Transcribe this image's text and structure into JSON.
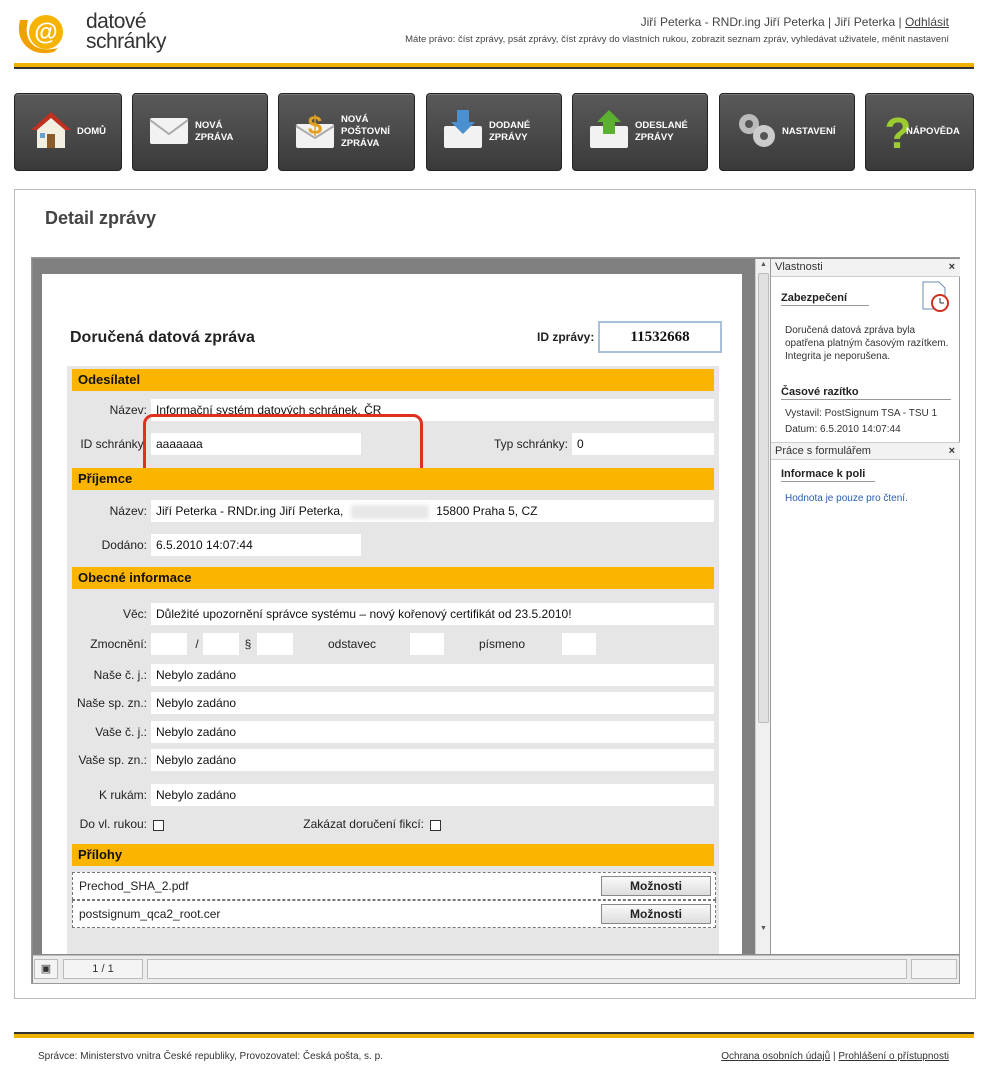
{
  "logo": {
    "line1": "datové",
    "line2": "schránky"
  },
  "header": {
    "user": "Jiří Peterka - RNDr.ing Jiří Peterka | Jiří Peterka |",
    "logout": "Odhlásit",
    "rights": "Máte právo: číst zprávy, psát zprávy, číst zprávy do vlastních rukou, zobrazit seznam zpráv, vyhledávat uživatele, měnit nastavení"
  },
  "nav": [
    {
      "label": "DOMŮ",
      "icon": "house-icon"
    },
    {
      "label": "NOVÁ\nZPRÁVA",
      "icon": "envelope-icon"
    },
    {
      "label": "NOVÁ\nPOŠTOVNÍ\nZPRÁVA",
      "icon": "dollar-envelope-icon"
    },
    {
      "label": "DODANÉ\nZPRÁVY",
      "icon": "inbox-icon"
    },
    {
      "label": "ODESLANÉ\nZPRÁVY",
      "icon": "outbox-icon"
    },
    {
      "label": "NASTAVENÍ",
      "icon": "gears-icon"
    },
    {
      "label": "NÁPOVĚDA",
      "icon": "question-icon"
    }
  ],
  "page_title": "Detail zprávy",
  "doc": {
    "title": "Doručená datová zpráva",
    "id_label": "ID zprávy:",
    "id_value": "11532668",
    "sender_section": "Odesílatel",
    "sender_name_label": "Název:",
    "sender_name": "Informační systém datových schránek, ČR",
    "sender_id_label": "ID schránky:",
    "sender_id": "aaaaaaa",
    "box_type_label": "Typ schránky:",
    "box_type": "0",
    "recipient_section": "Příjemce",
    "recipient_name_label": "Název:",
    "recipient_name": "Jiří Peterka - RNDr.ing Jiří Peterka,",
    "recipient_address": "15800 Praha 5, CZ",
    "delivered_label": "Dodáno:",
    "delivered": "6.5.2010 14:07:44",
    "general_section": "Obecné informace",
    "subject_label": "Věc:",
    "subject": "Důležité upozornění správce systému – nový kořenový certifikát od 23.5.2010!",
    "auth_label": "Zmocnění:",
    "auth_slash": "/",
    "auth_par": "§",
    "auth_odst": "odstavec",
    "auth_pism": "písmeno",
    "our_ref_label": "Naše č. j.:",
    "our_ref": "Nebylo zadáno",
    "our_file_label": "Naše sp. zn.:",
    "our_file": "Nebylo zadáno",
    "your_ref_label": "Vaše č. j.:",
    "your_ref": "Nebylo zadáno",
    "your_file_label": "Vaše sp. zn.:",
    "your_file": "Nebylo zadáno",
    "to_hands_label": "K rukám:",
    "to_hands": "Nebylo zadáno",
    "own_hands_label": "Do vl. rukou:",
    "no_fiction_label": "Zakázat doručení fikcí:",
    "attachments_section": "Přílohy",
    "attachments": [
      {
        "name": "Prechod_SHA_2.pdf",
        "button": "Možnosti"
      },
      {
        "name": "postsignum_qca2_root.cer",
        "button": "Možnosti"
      }
    ]
  },
  "side": {
    "props_head": "Vlastnosti",
    "security": "Zabezpečení",
    "security_text": "Doručená datová zpráva byla opatřena platným časovým razítkem. Integrita je neporušena.",
    "timestamp": "Časové razítko",
    "issuer": "Vystavil:  PostSignum TSA - TSU 1",
    "date": "Datum:   6.5.2010 14:07:44",
    "forms_head": "Práce s formulářem",
    "field_info": "Informace k poli",
    "field_info_text": "Hodnota je pouze pro čtení."
  },
  "status": {
    "page": "1 / 1"
  },
  "footer": {
    "left": "Správce: Ministerstvo vnitra České republiky, Provozovatel: Česká pošta, s. p.",
    "privacy": "Ochrana osobních údajů",
    "sep": " | ",
    "accessibility": "Prohlášení o přístupnosti"
  },
  "colors": {
    "accent": "#fbb400",
    "nav": "#444444",
    "highlight": "#e03020"
  }
}
